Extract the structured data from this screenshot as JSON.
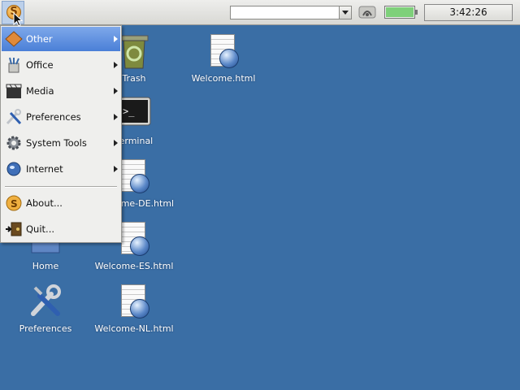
{
  "panel": {
    "menu_button_letter": "S",
    "clock": "3:42:26",
    "combo_value": ""
  },
  "desktop": {
    "icons": [
      {
        "label": "Trash",
        "icon": "trash-icon"
      },
      {
        "label": "Welcome.html",
        "icon": "html-document-icon"
      },
      {
        "label": "Terminal",
        "icon": "terminal-icon"
      },
      {
        "label": "Welcome-DE.html",
        "icon": "html-document-icon"
      },
      {
        "label": "Home",
        "icon": "home-folder-icon"
      },
      {
        "label": "Welcome-ES.html",
        "icon": "html-document-icon"
      },
      {
        "label": "Preferences",
        "icon": "tools-icon"
      },
      {
        "label": "Welcome-NL.html",
        "icon": "html-document-icon"
      }
    ]
  },
  "menu": {
    "items": [
      {
        "label": "Other",
        "icon": "other-icon",
        "submenu": true,
        "selected": true
      },
      {
        "label": "Office",
        "icon": "office-icon",
        "submenu": true
      },
      {
        "label": "Media",
        "icon": "media-icon",
        "submenu": true
      },
      {
        "label": "Preferences",
        "icon": "preferences-icon",
        "submenu": true
      },
      {
        "label": "System Tools",
        "icon": "gear-icon",
        "submenu": true
      },
      {
        "label": "Internet",
        "icon": "globe-icon",
        "submenu": true
      },
      {
        "label": "About...",
        "icon": "about-icon",
        "submenu": false
      },
      {
        "label": "Quit...",
        "icon": "quit-icon",
        "submenu": false
      }
    ]
  },
  "colors": {
    "desktop": "#3a6ea5",
    "menu_selection": "#4a7fd7"
  }
}
